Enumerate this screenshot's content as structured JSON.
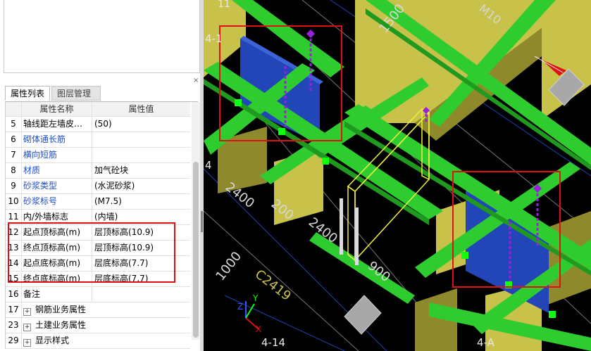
{
  "panel": {
    "close_glyph": "×",
    "tabs": [
      "属性列表",
      "图层管理"
    ],
    "grid_header": {
      "name": "属性名称",
      "value": "属性值"
    },
    "rows": [
      {
        "num": "5",
        "name": "轴线距左墙皮…",
        "value": "(50)",
        "blue": false
      },
      {
        "num": "6",
        "name": "砌体通长筋",
        "value": "",
        "blue": true
      },
      {
        "num": "7",
        "name": "横向短筋",
        "value": "",
        "blue": true
      },
      {
        "num": "8",
        "name": "材质",
        "value": "加气砼块",
        "blue": true
      },
      {
        "num": "9",
        "name": "砂浆类型",
        "value": "(水泥砂浆)",
        "blue": true
      },
      {
        "num": "10",
        "name": "砂浆标号",
        "value": "(M7.5)",
        "blue": true
      },
      {
        "num": "11",
        "name": "内/外墙标志",
        "value": "(内墙)",
        "blue": false
      },
      {
        "num": "12",
        "name": "起点顶标高(m)",
        "value": "层顶标高(10.9)",
        "blue": false
      },
      {
        "num": "13",
        "name": "终点顶标高(m)",
        "value": "层顶标高(10.9)",
        "blue": false
      },
      {
        "num": "14",
        "name": "起点底标高(m)",
        "value": "层底标高(7.7)",
        "blue": false
      },
      {
        "num": "15",
        "name": "终点底标高(m)",
        "value": "层底标高(7.7)",
        "blue": false
      },
      {
        "num": "16",
        "name": "备注",
        "value": "",
        "blue": false
      }
    ],
    "groups": [
      {
        "num": "17",
        "label": "钢筋业务属性"
      },
      {
        "num": "23",
        "label": "土建业务属性"
      },
      {
        "num": "29",
        "label": "显示样式"
      }
    ],
    "expand_glyph": "+"
  },
  "viewport": {
    "labels": {
      "axis_4_1": "4-1",
      "axis_4_14": "4-14",
      "axis_4_a": "4-A",
      "dim_2400_a": "2400",
      "dim_2400_b": "2400",
      "dim_200": "200",
      "dim_900": "900",
      "dim_1000": "1000",
      "dim_1500": "1500",
      "tag_c2419": "C2419",
      "tag_m10": "M10",
      "tag_4": "4",
      "axis_x": "X",
      "axis_y": "Y",
      "axis_z": "Z",
      "corner_11": "11"
    },
    "colors": {
      "background": "#000000",
      "beam": "#2fcc2f",
      "beam_dark": "#1f9a1f",
      "column": "#c8c24a",
      "column_dark": "#8e8a2c",
      "wall": "#2246b8",
      "wall_light": "#3a64d8",
      "highlight": "#e01010",
      "selection": "#f0f040",
      "marker": "#9b1fe0"
    }
  }
}
